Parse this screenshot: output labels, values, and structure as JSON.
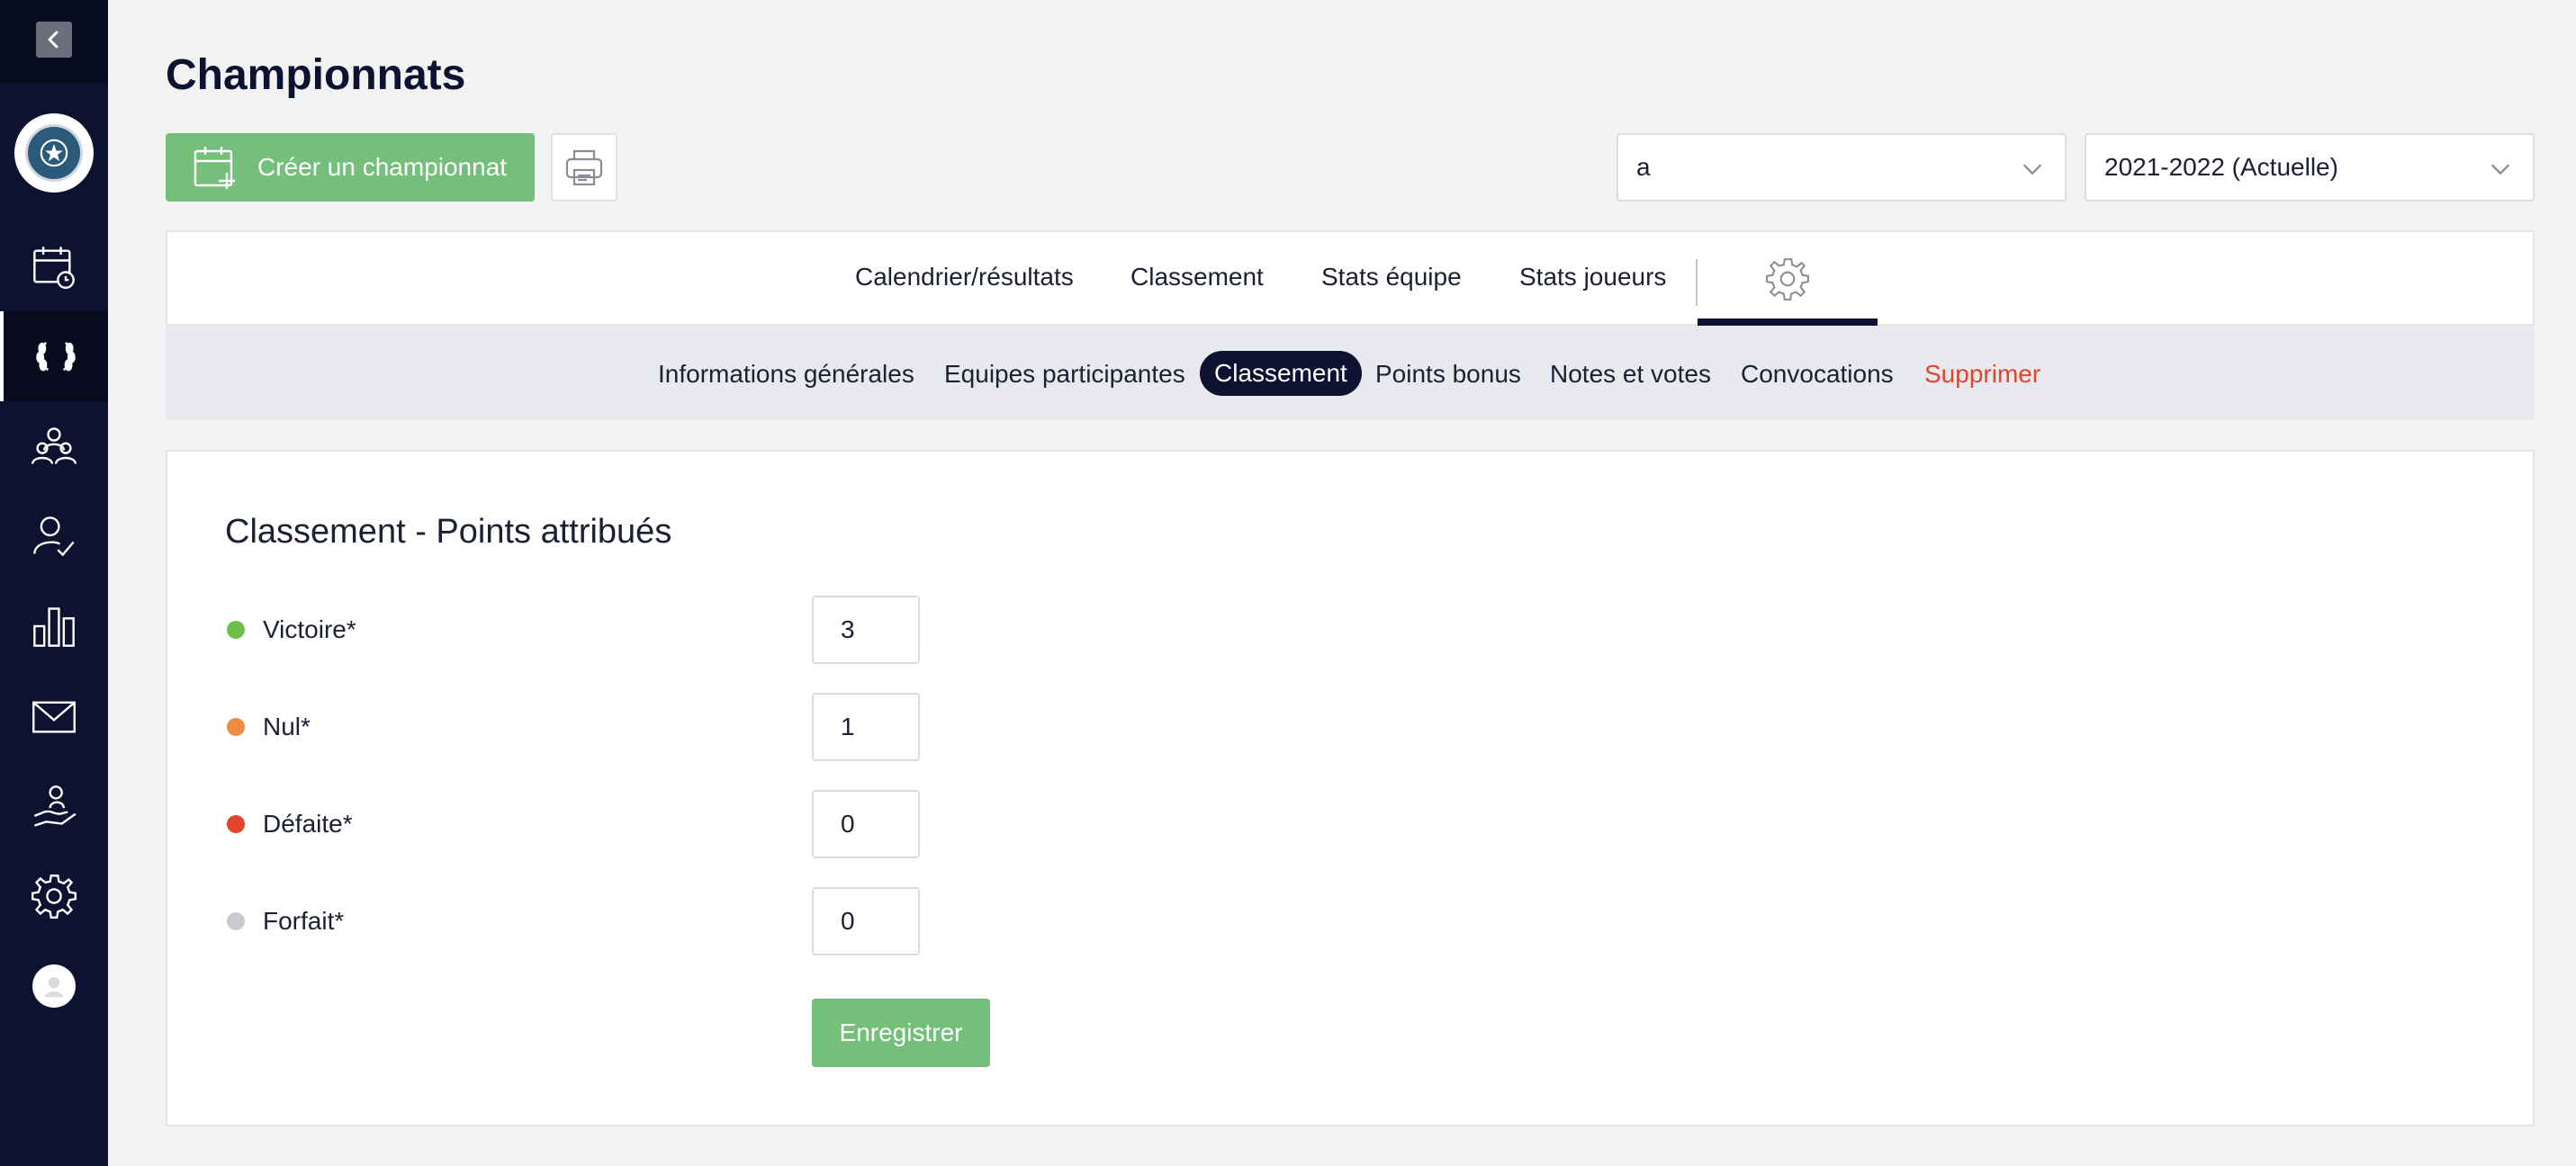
{
  "header": {
    "title": "Championnats",
    "create_label": "Créer un championnat",
    "filter_value": "a",
    "season_value": "2021-2022 (Actuelle)"
  },
  "tabs": [
    {
      "label": "Calendrier/résultats"
    },
    {
      "label": "Classement"
    },
    {
      "label": "Stats équipe"
    },
    {
      "label": "Stats joueurs"
    }
  ],
  "settings_tab_icon": "gear-icon",
  "subnav": [
    {
      "label": "Informations générales"
    },
    {
      "label": "Equipes participantes"
    },
    {
      "label": "Classement",
      "active": true
    },
    {
      "label": "Points bonus"
    },
    {
      "label": "Notes et votes"
    },
    {
      "label": "Convocations"
    },
    {
      "label": "Supprimer",
      "danger": true
    }
  ],
  "panel": {
    "title": "Classement - Points attribués",
    "rows": [
      {
        "label": "Victoire*",
        "value": "3",
        "color": "#6cc04a"
      },
      {
        "label": "Nul*",
        "value": "1",
        "color": "#ef8a45"
      },
      {
        "label": "Défaite*",
        "value": "0",
        "color": "#e2442f"
      },
      {
        "label": "Forfait*",
        "value": "0",
        "color": "#c8cad0"
      }
    ],
    "save_label": "Enregistrer"
  },
  "sidebar": {
    "items": [
      {
        "icon": "calendar-clock-icon"
      },
      {
        "icon": "laurel-icon",
        "active": true
      },
      {
        "icon": "group-icon"
      },
      {
        "icon": "user-check-icon"
      },
      {
        "icon": "bar-chart-icon"
      },
      {
        "icon": "mail-icon"
      },
      {
        "icon": "hand-user-icon"
      },
      {
        "icon": "gear-icon"
      }
    ]
  },
  "colors": {
    "sidebar": "#0c1230",
    "primary_green": "#74bf7a",
    "danger": "#e2442f"
  }
}
